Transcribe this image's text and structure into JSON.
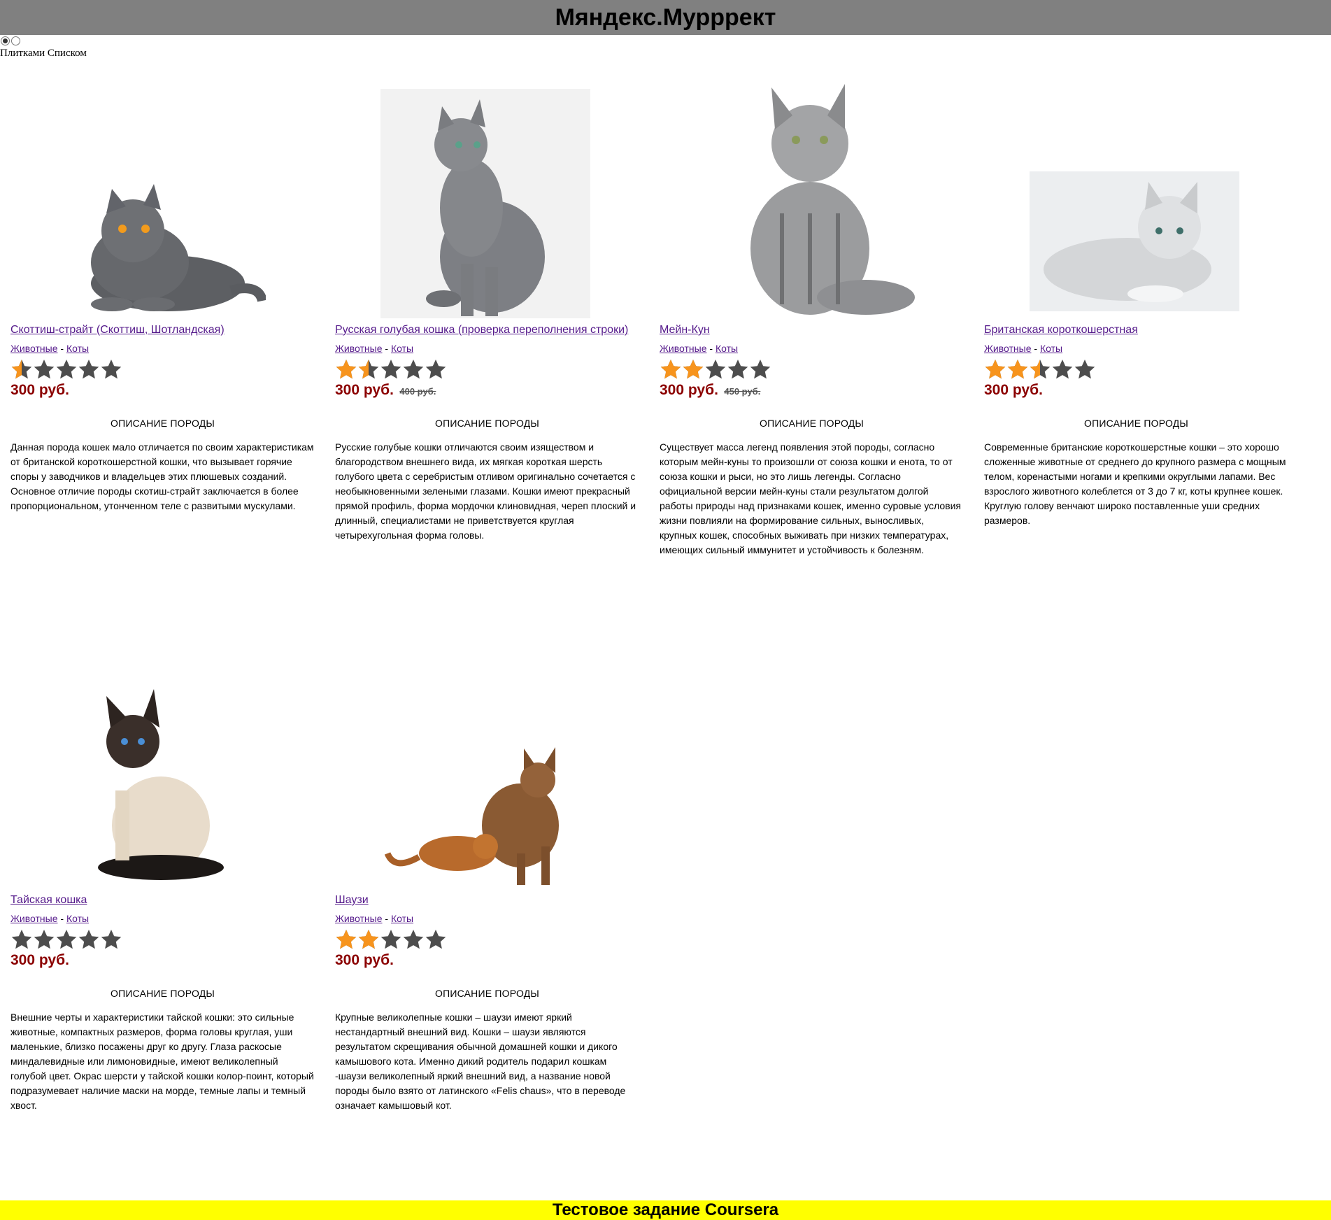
{
  "header": {
    "title": "Мяндекс.Мурррект"
  },
  "view_switch": {
    "tiles_label": "Плитками",
    "list_label": "Списком",
    "selected": "Плитками"
  },
  "breadcrumbs": {
    "sep": "-"
  },
  "products": [
    {
      "title": "Скоттиш-страйт (Скоттиш, Шотландская)",
      "crumb1": "Животные",
      "crumb2": "Коты",
      "rating": 0.5,
      "price": "300 руб.",
      "old_price": "",
      "desc_head": "ОПИСАНИЕ ПОРОДЫ",
      "desc": "Данная порода кошек мало отличается по своим характеристикам от британской короткошерстной кошки, что вызывает горячие споры у заводчиков и владельцев этих плюшевых созданий. Основное отличие породы скотиш-страйт заключается в более пропорциональном, утонченном теле с развитыми мускулами.",
      "image": "grey-lying-cat"
    },
    {
      "title": "Русская голубая кошка (проверка переполнения строки)",
      "crumb1": "Животные",
      "crumb2": "Коты",
      "rating": 1.5,
      "price": "300 руб.",
      "old_price": "400 руб.",
      "desc_head": "ОПИСАНИЕ ПОРОДЫ",
      "desc": "Русские голубые кошки отличаются своим изяществом и благородством внешнего вида, их мягкая короткая шерсть голубого цвета с серебристым отливом оригинально сочетается с необыкновенными зелеными глазами. Кошки имеют прекрасный прямой профиль, форма мордочки клиновидная, череп плоский и длинный, специалистами не приветствуется круглая четырехугольная форма головы.",
      "image": "russian-blue-cat"
    },
    {
      "title": "Мейн-Кун",
      "crumb1": "Животные",
      "crumb2": "Коты",
      "rating": 2,
      "price": "300 руб.",
      "old_price": "450 руб.",
      "desc_head": "ОПИСАНИЕ ПОРОДЫ",
      "desc": "Существует масса легенд появления этой породы, согласно которым мейн-куны то произошли от союза кошки и енота, то от союза кошки и рыси, но это лишь легенды. Согласно официальной версии мейн-куны стали результатом долгой работы природы над признаками кошек, именно суровые условия жизни повлияли на формирование сильных, выносливых, крупных кошек, способных выживать при низких температурах, имеющих сильный иммунитет и устойчивость к болезням.",
      "image": "maine-coon-cat"
    },
    {
      "title": "Британская короткошерстная",
      "crumb1": "Животные",
      "crumb2": "Коты",
      "rating": 2.5,
      "price": "300 руб.",
      "old_price": "",
      "desc_head": "ОПИСАНИЕ ПОРОДЫ",
      "desc": "Современные британские короткошерстные кошки – это хорошо сложенные животные от среднего до крупного размера с мощным телом, коренастыми ногами и крепкими округлыми лапами. Вес взрослого животного колеблется от 3 до 7 кг, коты крупнее кошек. Круглую голову венчают широко поставленные уши средних размеров.",
      "image": "british-silver-cat"
    },
    {
      "title": "Тайская кошка",
      "crumb1": "Животные",
      "crumb2": "Коты",
      "rating": 0,
      "price": "300 руб.",
      "old_price": "",
      "desc_head": "ОПИСАНИЕ ПОРОДЫ",
      "desc": "Внешние черты и характеристики тайской кошки: это сильные животные, компактных размеров, форма головы круглая, уши маленькие, близко посажены друг ко другу. Глаза раскосые миндалевидные или лимоновидные, имеют великолепный голубой цвет. Окрас шерсти у тайской кошки колор-поинт, который подразумевает наличие маски на морде, темные лапы и темный хвост.",
      "image": "thai-cat"
    },
    {
      "title": "Шаузи",
      "crumb1": "Животные",
      "crumb2": "Коты",
      "rating": 2,
      "price": "300 руб.",
      "old_price": "",
      "desc_head": "ОПИСАНИЕ ПОРОДЫ",
      "desc": "Крупные великолепные кошки – шаузи имеют яркий нестандартный внешний вид. Кошки – шаузи являются результатом скрещивания обычной домашней кошки и дикого камышового кота. Именно дикий родитель подарил кошкам -шаузи великолепный яркий внешний вид, а название новой породы было взято от латинского «Felis chaus», что в переводе означает камышовый кот.",
      "image": "chausie-cats"
    }
  ],
  "footer": {
    "text": "Тестовое задание Coursera"
  },
  "colors": {
    "header_bg": "#808080",
    "footer_bg": "#ffff00",
    "price": "#8b0000",
    "link": "#551a8b",
    "star_on": "#f7941d",
    "star_off": "#4d4d4d"
  }
}
